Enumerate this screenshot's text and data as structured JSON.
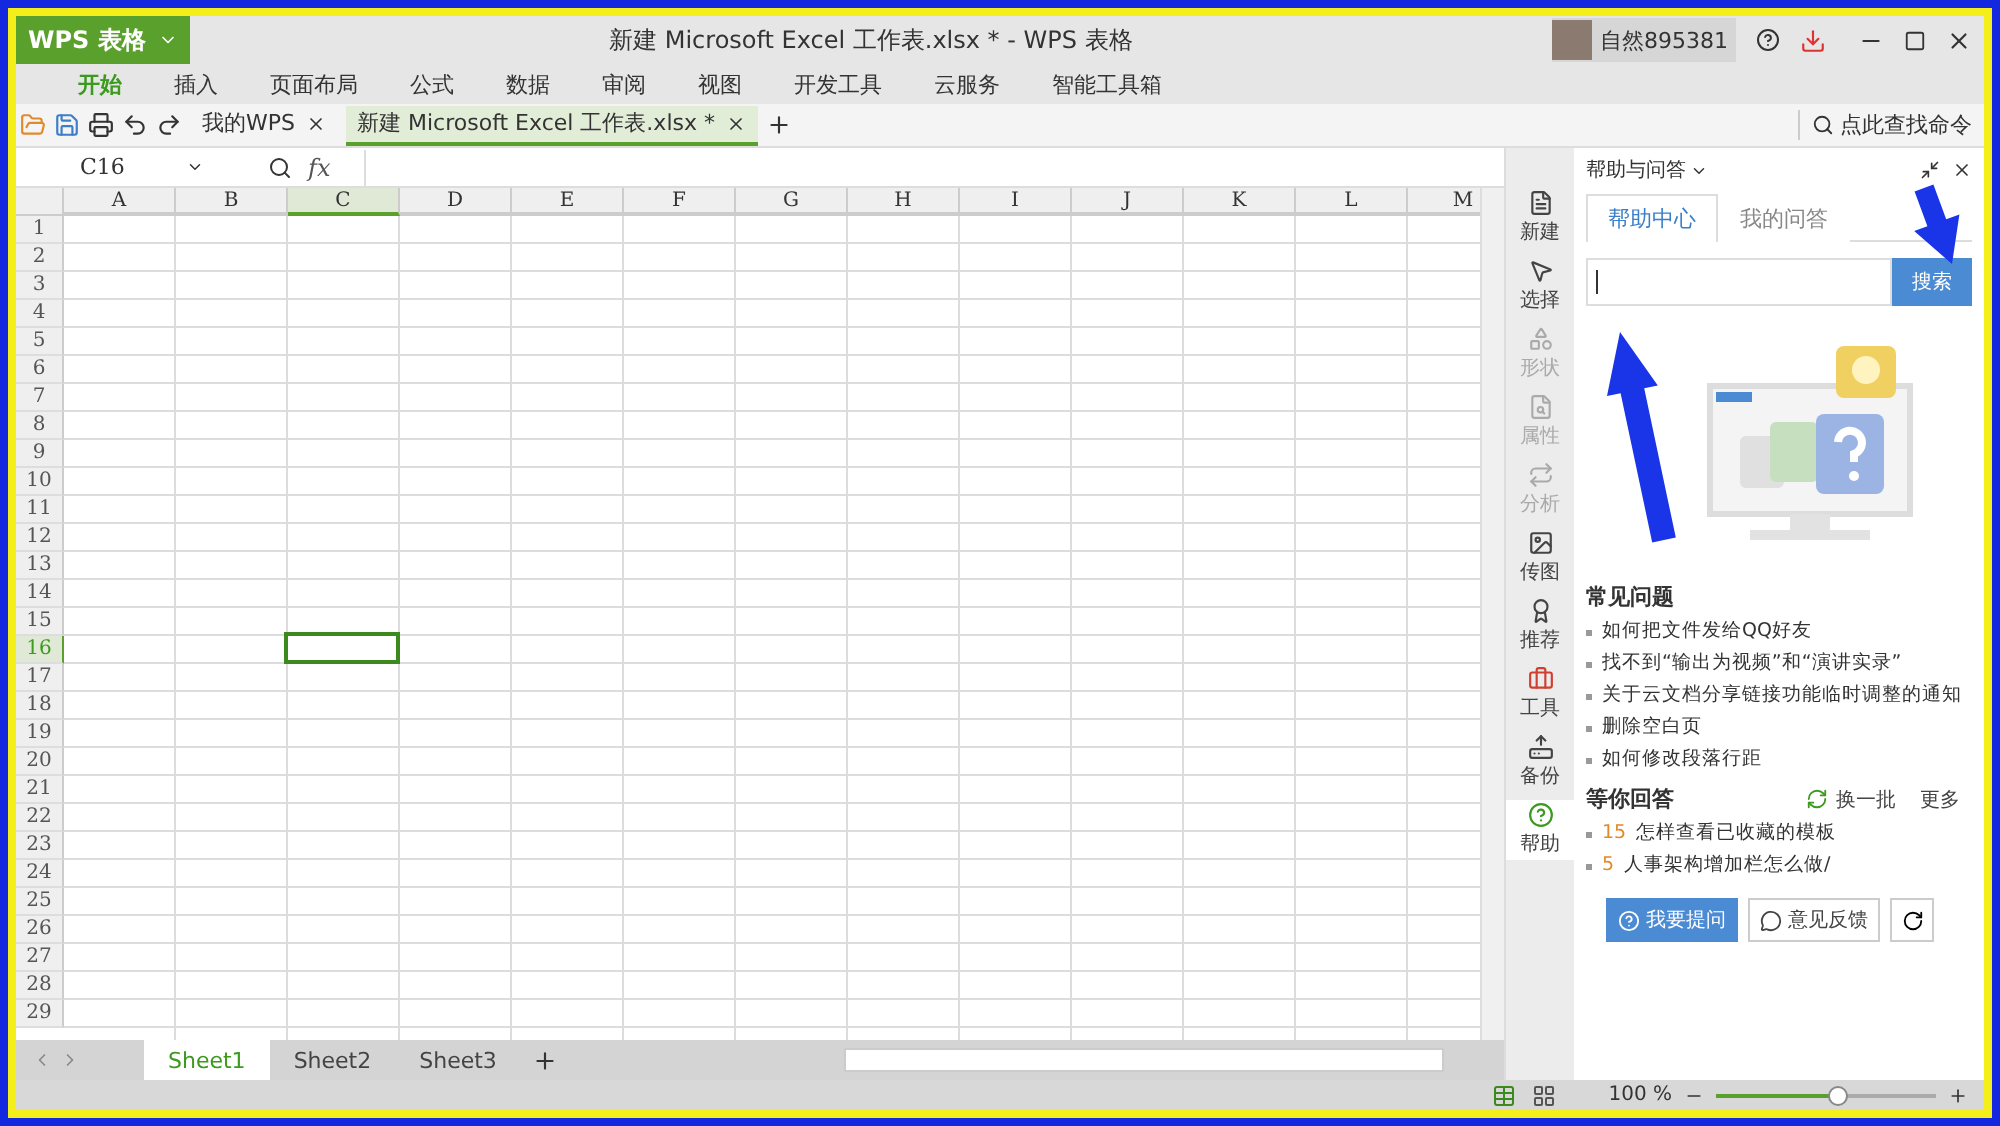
{
  "app": {
    "logo": "WPS 表格",
    "title": "新建 Microsoft Excel 工作表.xlsx * - WPS 表格",
    "user": "自然895381"
  },
  "menu": [
    {
      "label": "开始",
      "selected": true
    },
    {
      "label": "插入",
      "selected": false
    },
    {
      "label": "页面布局",
      "selected": false
    },
    {
      "label": "公式",
      "selected": false
    },
    {
      "label": "数据",
      "selected": false
    },
    {
      "label": "审阅",
      "selected": false
    },
    {
      "label": "视图",
      "selected": false
    },
    {
      "label": "开发工具",
      "selected": false
    },
    {
      "label": "云服务",
      "selected": false
    },
    {
      "label": "智能工具箱",
      "selected": false
    }
  ],
  "doc_tabs": [
    {
      "label": "我的WPS",
      "selected": false
    },
    {
      "label": "新建 Microsoft Excel 工作表.xlsx *",
      "selected": true
    }
  ],
  "command_search": {
    "placeholder": "点此查找命令"
  },
  "formula_bar": {
    "cell": "C16",
    "fx": "fx"
  },
  "grid": {
    "columns": [
      {
        "label": "A",
        "selected": false
      },
      {
        "label": "B",
        "selected": false
      },
      {
        "label": "C",
        "selected": true
      },
      {
        "label": "D",
        "selected": false
      },
      {
        "label": "E",
        "selected": false
      },
      {
        "label": "F",
        "selected": false
      },
      {
        "label": "G",
        "selected": false
      },
      {
        "label": "H",
        "selected": false
      },
      {
        "label": "I",
        "selected": false
      },
      {
        "label": "J",
        "selected": false
      },
      {
        "label": "K",
        "selected": false
      },
      {
        "label": "L",
        "selected": false
      },
      {
        "label": "M",
        "selected": false
      }
    ],
    "rows": [
      {
        "label": "1",
        "selected": false
      },
      {
        "label": "2",
        "selected": false
      },
      {
        "label": "3",
        "selected": false
      },
      {
        "label": "4",
        "selected": false
      },
      {
        "label": "5",
        "selected": false
      },
      {
        "label": "6",
        "selected": false
      },
      {
        "label": "7",
        "selected": false
      },
      {
        "label": "8",
        "selected": false
      },
      {
        "label": "9",
        "selected": false
      },
      {
        "label": "10",
        "selected": false
      },
      {
        "label": "11",
        "selected": false
      },
      {
        "label": "12",
        "selected": false
      },
      {
        "label": "13",
        "selected": false
      },
      {
        "label": "14",
        "selected": false
      },
      {
        "label": "15",
        "selected": false
      },
      {
        "label": "16",
        "selected": true
      },
      {
        "label": "17",
        "selected": false
      },
      {
        "label": "18",
        "selected": false
      },
      {
        "label": "19",
        "selected": false
      },
      {
        "label": "20",
        "selected": false
      },
      {
        "label": "21",
        "selected": false
      },
      {
        "label": "22",
        "selected": false
      },
      {
        "label": "23",
        "selected": false
      },
      {
        "label": "24",
        "selected": false
      },
      {
        "label": "25",
        "selected": false
      },
      {
        "label": "26",
        "selected": false
      },
      {
        "label": "27",
        "selected": false
      },
      {
        "label": "28",
        "selected": false
      },
      {
        "label": "29",
        "selected": false
      }
    ]
  },
  "sheet_tabs": [
    {
      "label": "Sheet1",
      "selected": true
    },
    {
      "label": "Sheet2",
      "selected": false
    },
    {
      "label": "Sheet3",
      "selected": false
    }
  ],
  "side_tools": [
    {
      "label": "新建",
      "kind": "file",
      "disabled": false,
      "selected": false
    },
    {
      "label": "选择",
      "kind": "select",
      "disabled": false,
      "selected": false
    },
    {
      "label": "形状",
      "kind": "shape",
      "disabled": true,
      "selected": false
    },
    {
      "label": "属性",
      "kind": "props",
      "disabled": true,
      "selected": false
    },
    {
      "label": "分析",
      "kind": "analyze",
      "disabled": true,
      "selected": false
    },
    {
      "label": "传图",
      "kind": "image",
      "disabled": false,
      "selected": false
    },
    {
      "label": "推荐",
      "kind": "award",
      "disabled": false,
      "selected": false
    },
    {
      "label": "工具",
      "kind": "toolbox",
      "disabled": false,
      "selected": false
    },
    {
      "label": "备份",
      "kind": "backup",
      "disabled": false,
      "selected": false
    },
    {
      "label": "帮助",
      "kind": "help",
      "disabled": false,
      "selected": true
    }
  ],
  "help_panel": {
    "title": "帮助与问答",
    "tabs": [
      {
        "label": "帮助中心",
        "selected": true
      },
      {
        "label": "我的问答",
        "selected": false
      }
    ],
    "search_button": "搜索",
    "faq_title": "常见问题",
    "faq": [
      "如何把文件发给QQ好友",
      "找不到“输出为视频”和“演讲实录”",
      "关于云文档分享链接功能临时调整的通知",
      "删除空白页",
      "如何修改段落行距"
    ],
    "waiting_title": "等你回答",
    "refresh": "换一批",
    "more": "更多",
    "waiting": [
      {
        "count": "15",
        "text": "怎样查看已收藏的模板"
      },
      {
        "count": "5",
        "text": "人事架构增加栏怎么做/"
      }
    ],
    "ask_button": "我要提问",
    "feedback_button": "意见反馈"
  },
  "status": {
    "zoom": "100 %",
    "level": 0.55
  }
}
